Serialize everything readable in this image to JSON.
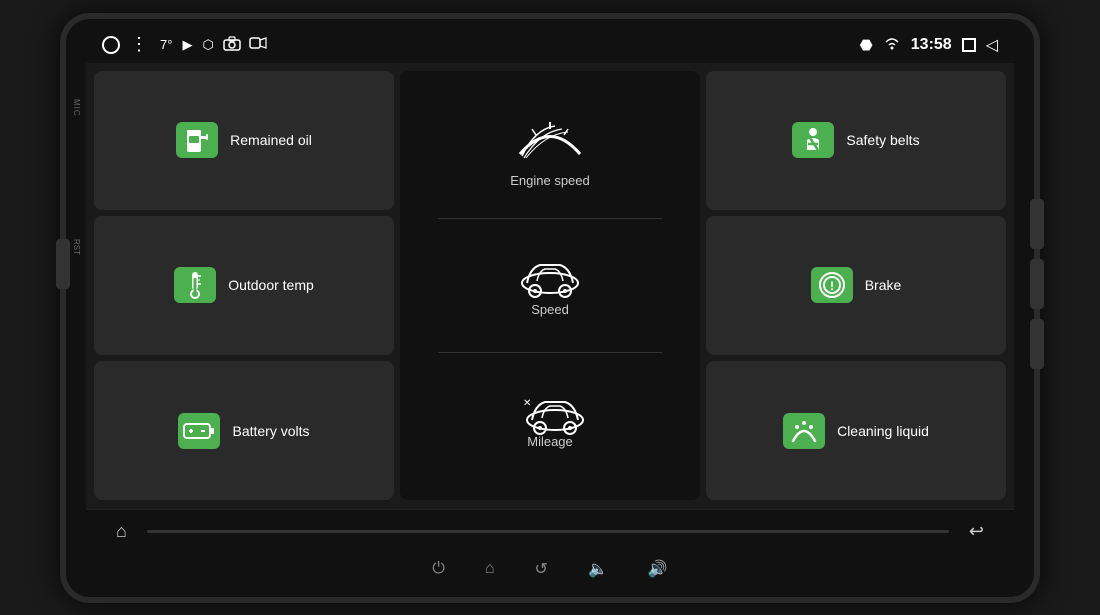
{
  "device": {
    "mic_label": "MIC",
    "rst_label": "RST"
  },
  "status_bar": {
    "temperature": "7°",
    "time": "13:58",
    "icons": {
      "home": "○",
      "dots": "⋮",
      "bluetooth": "⊔",
      "wifi": "▲",
      "square": "□",
      "back": "◁"
    }
  },
  "cards": {
    "remained_oil": {
      "label": "Remained oil",
      "icon": "fuel"
    },
    "outdoor_temp": {
      "label": "Outdoor temp",
      "icon": "thermometer"
    },
    "battery_volts": {
      "label": "Battery volts",
      "icon": "battery"
    },
    "safety_belts": {
      "label": "Safety belts",
      "icon": "seatbelt"
    },
    "brake": {
      "label": "Brake",
      "icon": "brake"
    },
    "cleaning_liquid": {
      "label": "Cleaning liquid",
      "icon": "wiper"
    }
  },
  "center": {
    "engine_speed_label": "Engine speed",
    "speed_label": "Speed",
    "mileage_label": "Mileage"
  },
  "nav": {
    "home_label": "⌂",
    "back_label": "↩"
  },
  "system_bar": {
    "power": "⏻",
    "home": "⌂",
    "back": "↺",
    "volume_down": "🔈",
    "volume_up": "🔊"
  }
}
